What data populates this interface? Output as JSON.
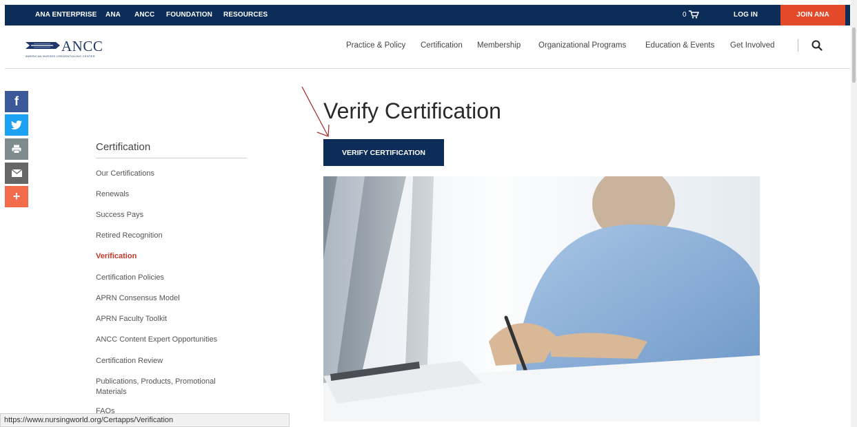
{
  "topbar": {
    "links": [
      "ANA ENTERPRISE",
      "ANA",
      "ANCC",
      "FOUNDATION",
      "RESOURCES"
    ],
    "cart_count": "0",
    "login": "LOG IN",
    "join": "JOIN ANA"
  },
  "header": {
    "logo_word": "ANCC",
    "logo_sub": "AMERICAN NURSES CREDENTIALING CENTER",
    "nav": [
      "Practice & Policy",
      "Certification",
      "Membership",
      "Organizational Programs",
      "Education & Events",
      "Get Involved"
    ]
  },
  "share": {
    "facebook": "f",
    "plus": "+"
  },
  "sidebar": {
    "title": "Certification",
    "items": [
      "Our Certifications",
      "Renewals",
      "Success Pays",
      "Retired Recognition",
      "Verification",
      "Certification Policies",
      "APRN Consensus Model",
      "APRN Faculty Toolkit",
      "ANCC Content Expert Opportunities",
      "Certification Review",
      "Publications, Products, Promotional Materials",
      "FAQs"
    ],
    "active_index": 4
  },
  "main": {
    "title": "Verify Certification",
    "button": "VERIFY CERTIFICATION"
  },
  "status_url": "https://www.nursingworld.org/Certapps/Verification",
  "colors": {
    "navy": "#0b2d57",
    "join": "#e24a2a",
    "facebook": "#3b5998",
    "twitter": "#1da1f2",
    "print": "#7f8c8d",
    "email": "#666666",
    "share_more": "#f26b4a",
    "active_link": "#c0392b",
    "annotation_arrow": "#a83232"
  }
}
